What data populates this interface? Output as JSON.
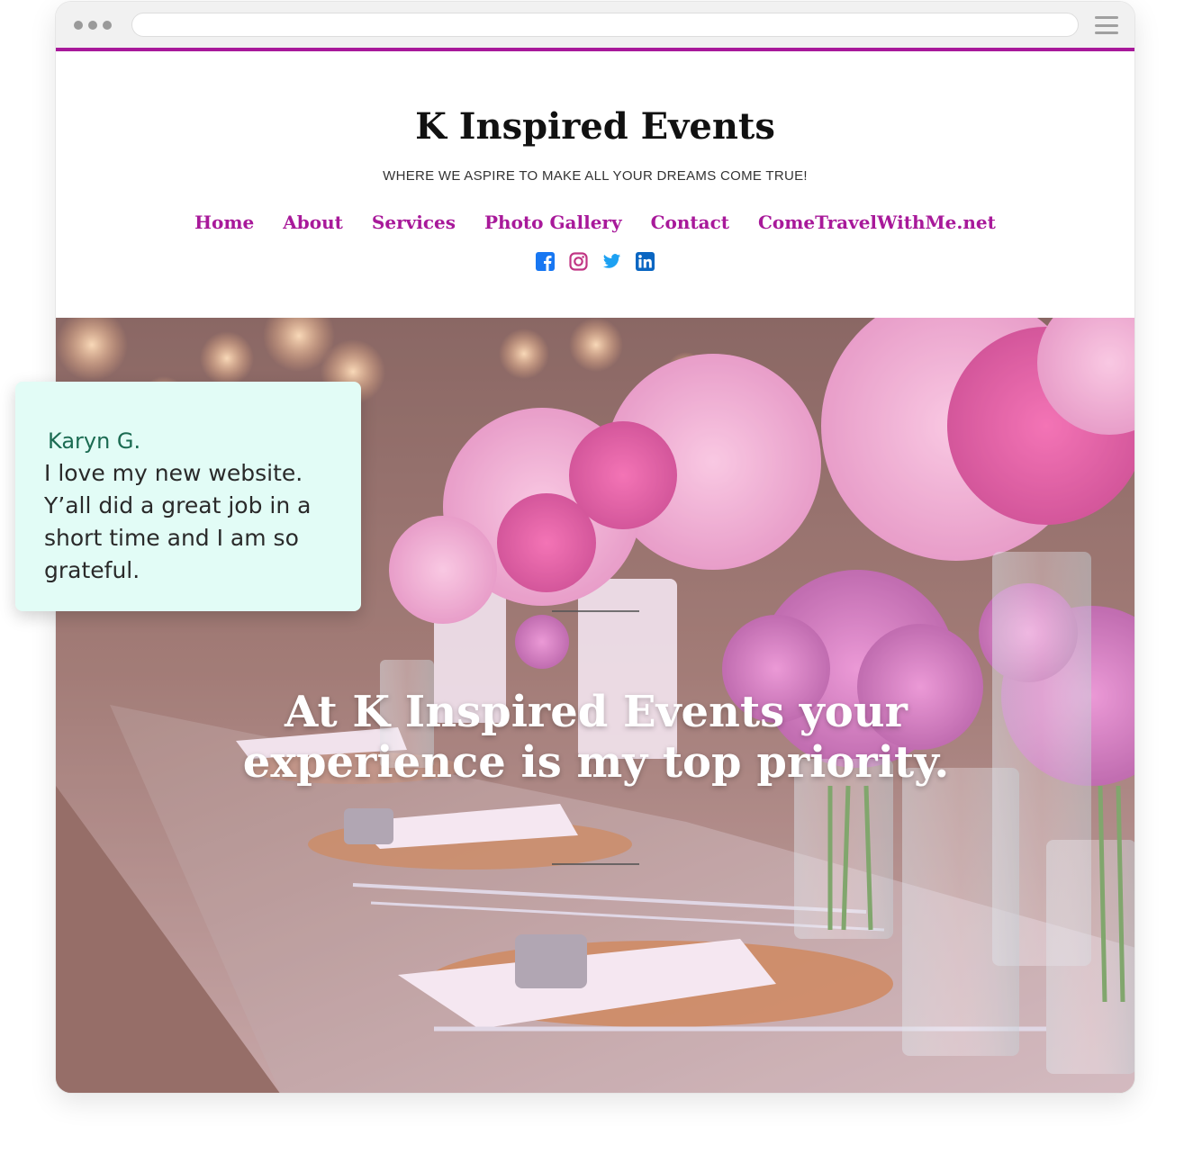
{
  "site": {
    "title": "K Inspired Events",
    "tagline": "WHERE WE ASPIRE TO MAKE ALL YOUR DREAMS COME TRUE!"
  },
  "nav": [
    {
      "label": "Home"
    },
    {
      "label": "About"
    },
    {
      "label": "Services"
    },
    {
      "label": "Photo Gallery"
    },
    {
      "label": "Contact"
    },
    {
      "label": "ComeTravelWithMe.net"
    }
  ],
  "social": [
    {
      "icon": "facebook-icon",
      "color": "#1877f2"
    },
    {
      "icon": "instagram-icon",
      "color": "#c13584"
    },
    {
      "icon": "twitter-icon",
      "color": "#1da1f2"
    },
    {
      "icon": "linkedin-icon",
      "color": "#0a66c2"
    }
  ],
  "hero": {
    "line1": "At K Inspired Events your",
    "line2": "experience is my top priority."
  },
  "testimonial": {
    "author": "Karyn G.",
    "quote": "I love my new website. Y’all did a great job in a short time and I am so grateful."
  },
  "colors": {
    "accent": "#a8199a",
    "testimonial_bg": "#e2fcf6",
    "testimonial_author": "#1b6b52"
  }
}
